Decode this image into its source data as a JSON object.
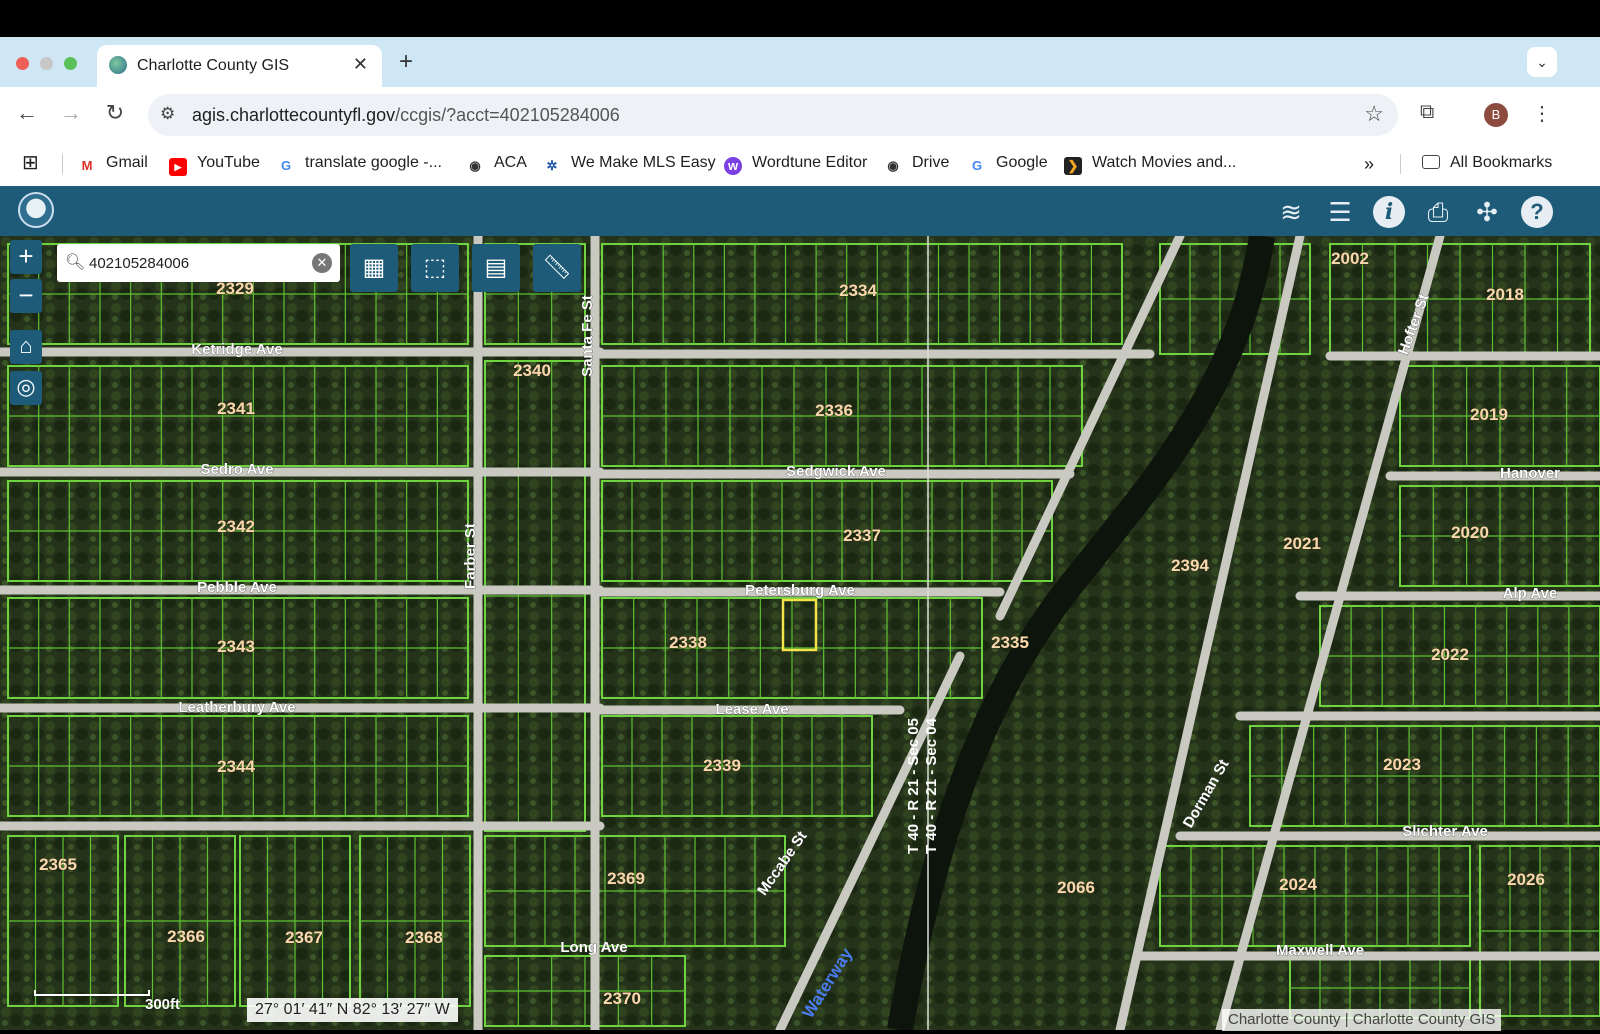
{
  "browser": {
    "tab_title": "Charlotte County GIS",
    "url_host": "agis.charlottecountyfl.gov",
    "url_path": "/ccgis/?acct=402105284006",
    "profile_initial": "B"
  },
  "bookmarks": [
    {
      "label": "Gmail",
      "icon": "gmail-icon"
    },
    {
      "label": "YouTube",
      "icon": "youtube-icon"
    },
    {
      "label": "translate google -...",
      "icon": "google-icon"
    },
    {
      "label": "ACA",
      "icon": "globe-icon"
    },
    {
      "label": "We Make MLS Easy",
      "icon": "gear-icon"
    },
    {
      "label": "Wordtune Editor",
      "icon": "wordtune-icon"
    },
    {
      "label": "Drive",
      "icon": "globe-icon"
    },
    {
      "label": "Google",
      "icon": "google-icon"
    },
    {
      "label": "Watch Movies and...",
      "icon": "movie-icon"
    }
  ],
  "all_bookmarks_label": "All Bookmarks",
  "search": {
    "value": "402105284006"
  },
  "map": {
    "streets": [
      "Ketridge Ave",
      "Sedro Ave",
      "Pebble Ave",
      "Leatherbury Ave",
      "Sedgwick Ave",
      "Petersburg Ave",
      "Lease Ave",
      "Long Ave",
      "Hanover",
      "Alp Ave",
      "Slichter Ave",
      "Maxwell Ave",
      "Santa Fe St",
      "Farber St",
      "Mccabe St",
      "Dorman St",
      "Hofter St"
    ],
    "blocks": [
      "2329",
      "2334",
      "2002",
      "2018",
      "2340",
      "2341",
      "2336",
      "2019",
      "2342",
      "2337",
      "2394",
      "2021",
      "2020",
      "2343",
      "2338",
      "2335",
      "2022",
      "2344",
      "2339",
      "2023",
      "2365",
      "2366",
      "2367",
      "2368",
      "2369",
      "2066",
      "2024",
      "2026",
      "2370"
    ],
    "sections": [
      "T 40 - R 21 - Sec 05",
      "T 40 - R 21 - Sec 04"
    ],
    "waterway": "Waterway"
  },
  "scale_label": "300ft",
  "coordinates": "27° 01′ 41″ N 82° 13′ 27″ W",
  "attribution": "Charlotte County | Charlotte County GIS"
}
